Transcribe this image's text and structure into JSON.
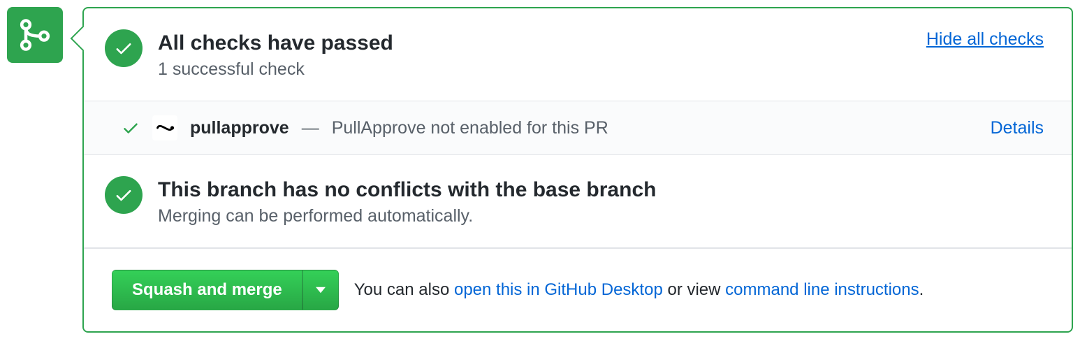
{
  "checks_summary": {
    "title": "All checks have passed",
    "subtitle": "1 successful check",
    "toggle_label": "Hide all checks"
  },
  "check_items": [
    {
      "name": "pullapprove",
      "separator": " — ",
      "description": "PullApprove not enabled for this PR",
      "action_label": "Details"
    }
  ],
  "conflicts": {
    "title": "This branch has no conflicts with the base branch",
    "subtitle": "Merging can be performed automatically."
  },
  "merge": {
    "button_label": "Squash and merge",
    "footer_prefix": "You can also ",
    "desktop_link": "open this in GitHub Desktop",
    "footer_middle": " or view ",
    "cli_link": "command line instructions",
    "footer_suffix": "."
  }
}
